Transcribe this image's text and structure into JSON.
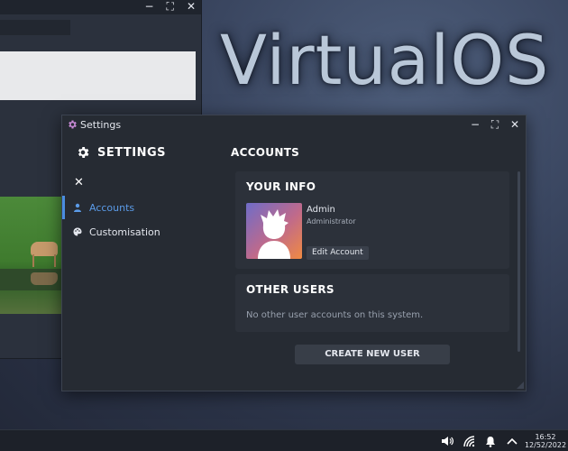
{
  "desktop": {
    "brand_text": "VirtualOS"
  },
  "background_window": {
    "controls": [
      "minimize",
      "maximize",
      "close"
    ]
  },
  "settings_window": {
    "title": "Settings",
    "sidebar": {
      "heading": "SETTINGS",
      "items": [
        {
          "label": "Accounts",
          "icon": "user-icon",
          "active": true
        },
        {
          "label": "Customisation",
          "icon": "palette-icon",
          "active": false
        }
      ]
    },
    "content": {
      "title": "ACCOUNTS",
      "your_info": {
        "heading": "YOUR INFO",
        "name": "Admin",
        "role": "Administrator",
        "edit_button": "Edit Account"
      },
      "other_users": {
        "heading": "OTHER USERS",
        "empty_text": "No other user accounts on this system."
      },
      "create_button": "CREATE NEW USER"
    },
    "accent_color": "#4a8de0"
  },
  "taskbar": {
    "tray_icons": [
      "volume-icon",
      "wifi-icon",
      "notification-bell-icon",
      "chevron-up-icon"
    ],
    "time": "16:52",
    "date": "12/52/2022"
  }
}
